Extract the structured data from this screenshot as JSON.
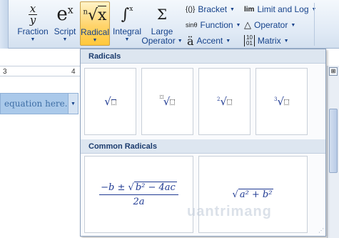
{
  "ribbon": {
    "buttons": [
      {
        "label": "Fraction",
        "glyph": "x/y"
      },
      {
        "label": "Script",
        "glyph": "e^x"
      },
      {
        "label": "Radical",
        "glyph": "n√x"
      },
      {
        "label": "Integral",
        "glyph": "∫"
      },
      {
        "label": "Large",
        "label2": "Operator",
        "glyph": "Σ"
      }
    ],
    "small": [
      {
        "label": "Bracket",
        "icon": "{()}"
      },
      {
        "label": "Function",
        "icon": "sinθ"
      },
      {
        "label": "Accent",
        "icon": "ä"
      },
      {
        "label": "Limit and Log",
        "icon": "lim"
      },
      {
        "label": "Operator",
        "icon": "△"
      },
      {
        "label": "Matrix",
        "icon": "[10 01]"
      }
    ]
  },
  "document": {
    "ruler_marks": [
      "3",
      "4"
    ],
    "equation_placeholder": "equation here."
  },
  "panel": {
    "section1": "Radicals",
    "section2": "Common Radicals",
    "quadratic": {
      "numerator_left": "−b ± ",
      "radicand": "b² − 4ac",
      "denominator": "2a"
    },
    "pythag": {
      "radicand": "a² + b²"
    },
    "tile_degree_2": "2",
    "tile_degree_3": "3"
  },
  "watermark": "uantrimang"
}
